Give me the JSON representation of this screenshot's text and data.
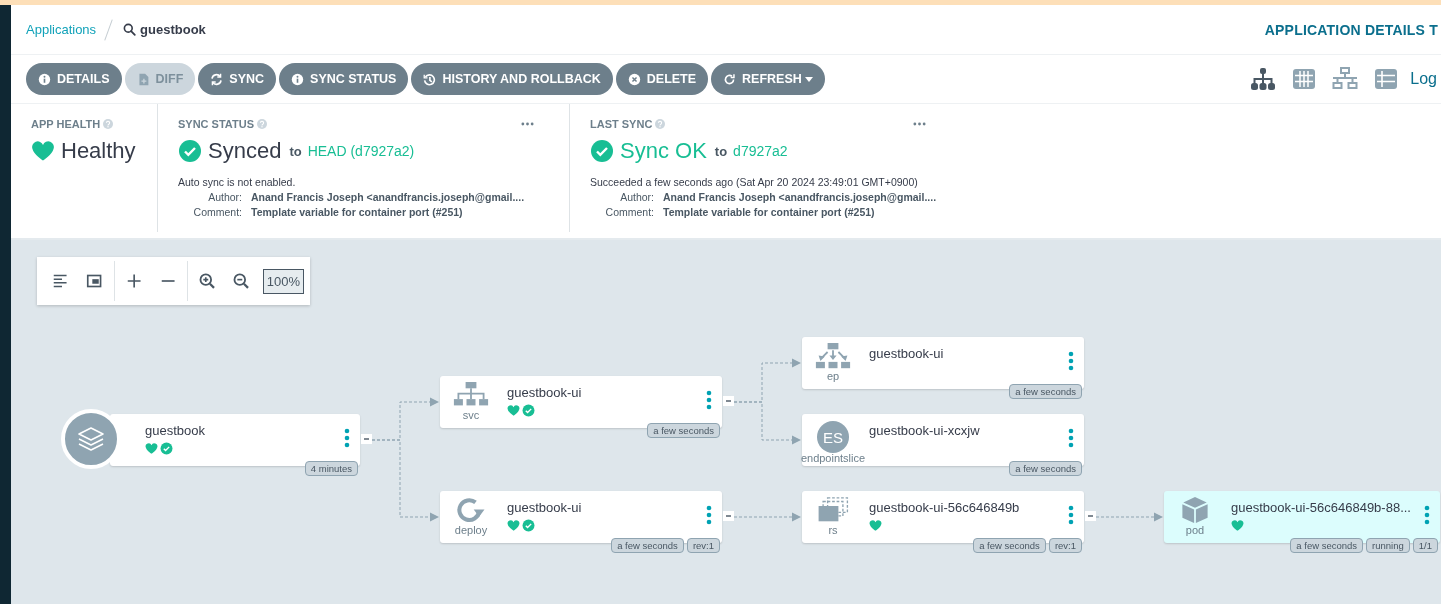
{
  "breadcrumb": {
    "root": "Applications",
    "current": "guestbook"
  },
  "page_title": "APPLICATION DETAILS T",
  "toolbar": {
    "buttons": [
      {
        "kind": "details",
        "label": "DETAILS",
        "disabled": false
      },
      {
        "kind": "diff",
        "label": "DIFF",
        "disabled": true
      },
      {
        "kind": "sync",
        "label": "SYNC",
        "disabled": false
      },
      {
        "kind": "sync_status",
        "label": "SYNC STATUS",
        "disabled": false
      },
      {
        "kind": "history",
        "label": "HISTORY AND ROLLBACK",
        "disabled": false
      },
      {
        "kind": "delete",
        "label": "DELETE",
        "disabled": false
      },
      {
        "kind": "refresh",
        "label": "REFRESH",
        "disabled": false
      }
    ],
    "views": [
      {
        "kind": "tree",
        "selected": true
      },
      {
        "kind": "grid",
        "selected": false
      },
      {
        "kind": "network",
        "selected": false
      },
      {
        "kind": "list",
        "selected": false
      }
    ],
    "logs_link": "Log"
  },
  "status": {
    "app_health": {
      "title": "APP HEALTH",
      "value": "Healthy"
    },
    "sync_status": {
      "title": "SYNC STATUS",
      "value": "Synced",
      "to": "to",
      "revision": "HEAD (d7927a2)",
      "note": "Auto sync is not enabled.",
      "details": [
        {
          "label": "Author:",
          "value": "Anand Francis Joseph <anandfrancis.joseph@gmail...."
        },
        {
          "label": "Comment:",
          "value": "Template variable for container port (#251)"
        }
      ]
    },
    "last_sync": {
      "title": "LAST SYNC",
      "value": "Sync OK",
      "to": "to",
      "revision": "d7927a2",
      "note": "Succeeded a few seconds ago (Sat Apr 20 2024 23:49:01 GMT+0900)",
      "details": [
        {
          "label": "Author:",
          "value": "Anand Francis Joseph <anandfrancis.joseph@gmail...."
        },
        {
          "label": "Comment:",
          "value": "Template variable for container port (#251)"
        }
      ]
    }
  },
  "graph": {
    "zoom": "100%",
    "nodes": [
      {
        "kind": "app",
        "name": "guestbook",
        "healthy": true,
        "synced": true,
        "highlighted": false,
        "expanded": true,
        "tags": [
          "4 minutes"
        ],
        "children": [
          {
            "kind": "svc",
            "type_label": "svc",
            "name": "guestbook-ui",
            "healthy": true,
            "synced": true,
            "highlighted": false,
            "expanded": true,
            "tags": [
              "a few seconds"
            ],
            "children": [
              {
                "kind": "ep",
                "type_label": "ep",
                "name": "guestbook-ui",
                "healthy": false,
                "synced": false,
                "highlighted": false,
                "tags": [
                  "a few seconds"
                ]
              },
              {
                "kind": "endpointslice",
                "type_label": "endpointslice",
                "icon_text": "ES",
                "name": "guestbook-ui-xcxjw",
                "healthy": false,
                "synced": false,
                "highlighted": false,
                "tags": [
                  "a few seconds"
                ]
              }
            ]
          },
          {
            "kind": "deploy",
            "type_label": "deploy",
            "name": "guestbook-ui",
            "healthy": true,
            "synced": true,
            "highlighted": false,
            "expanded": true,
            "tags": [
              "a few seconds",
              "rev:1"
            ],
            "children": [
              {
                "kind": "rs",
                "type_label": "rs",
                "name": "guestbook-ui-56c646849b",
                "healthy": true,
                "synced": false,
                "highlighted": false,
                "expanded": true,
                "tags": [
                  "a few seconds",
                  "rev:1"
                ],
                "children": [
                  {
                    "kind": "pod",
                    "type_label": "pod",
                    "name": "guestbook-ui-56c646849b-88...",
                    "healthy": true,
                    "synced": false,
                    "highlighted": true,
                    "tags": [
                      "a few seconds",
                      "running",
                      "1/1"
                    ]
                  }
                ]
              }
            ]
          }
        ]
      }
    ]
  }
}
